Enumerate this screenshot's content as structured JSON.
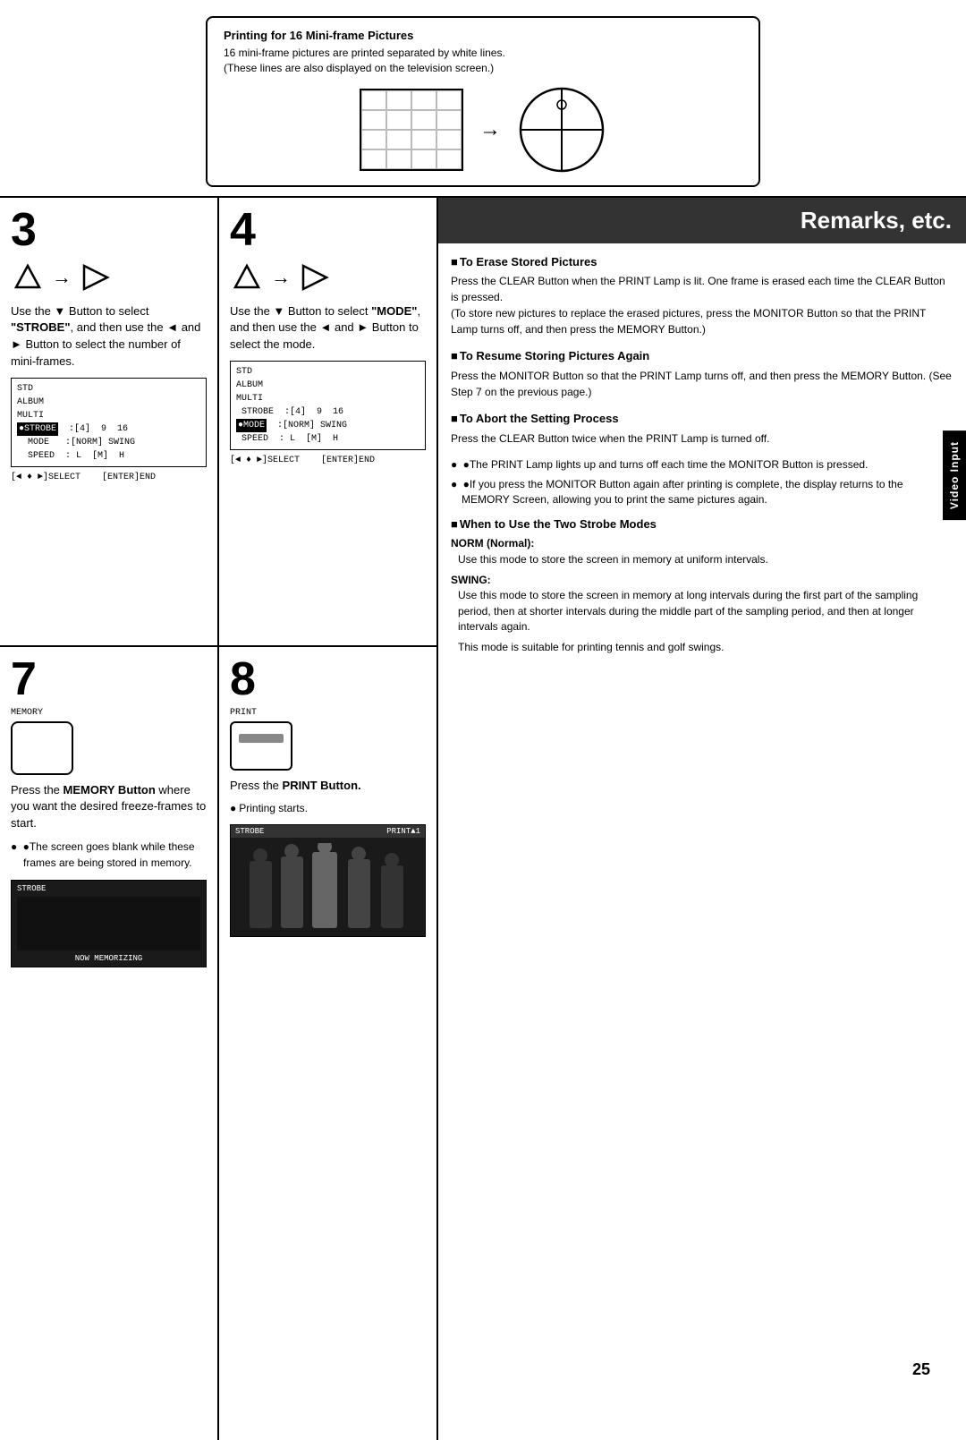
{
  "top": {
    "print_info_title": "Printing for 16 Mini-frame Pictures",
    "print_info_line1": "16 mini-frame pictures are printed separated by white lines.",
    "print_info_line2": "(These lines are also displayed on the television screen.)"
  },
  "steps": {
    "step3": {
      "number": "3",
      "description_html": "Use the ▼ Button to select \"STROBE\", and then use the ◄ and ► Button to select the number of mini-frames.",
      "menu": {
        "lines": [
          "STD",
          "ALBUM",
          "MULTI",
          "●STROBE  :[4]  9  16",
          "MODE  :[NORM]  SWING",
          "SPEED  : L  [M]  H"
        ],
        "footer": "[◄ ♦ ►]SELECT   [ENTER]END"
      }
    },
    "step4": {
      "number": "4",
      "description_html": "Use the ▼ Button to select \"MODE\", and then use the ◄ and ► Button to select the mode.",
      "menu": {
        "lines": [
          "STD",
          "ALBUM",
          "MULTI",
          "STROBE  :[4]  9  16",
          "●MODE  :[NORM]  SWING",
          "SPEED  : L  [M]  H"
        ],
        "footer": "[◄ ♦ ►]SELECT   [ENTER]END"
      }
    },
    "step7": {
      "number": "7",
      "memory_label": "MEMORY",
      "description": "Press the MEMORY Button where you want the desired freeze-frames to start.",
      "bullet1": "The screen goes blank while these frames are being stored in memory.",
      "strobe_label": "STROBE",
      "now_memorizing": "NOW MEMORIZING"
    },
    "step8": {
      "number": "8",
      "print_label": "PRINT",
      "description": "Press the PRINT Button.",
      "bullet1": "Printing starts.",
      "strobe_label": "STROBE",
      "print1_label": "PRINT▲1"
    }
  },
  "remarks": {
    "header": "Remarks, etc.",
    "erase_title": "To Erase Stored Pictures",
    "erase_text": "Press the CLEAR Button when the PRINT Lamp is lit. One frame is erased each time the CLEAR Button is pressed.\n(To store new pictures to replace the erased pictures, press the MONITOR Button so that the PRINT Lamp turns off, and then press the MEMORY Button.)",
    "resume_title": "To Resume Storing Pictures Again",
    "resume_text": "Press the MONITOR Button so that the PRINT Lamp turns off, and then press the MEMORY Button. (See Step 7 on the previous page.)",
    "abort_title": "To Abort the Setting Process",
    "abort_text": "Press the CLEAR Button twice when the PRINT Lamp is turned off.",
    "bullet1": "The PRINT Lamp lights up and turns off each time the MONITOR Button is pressed.",
    "bullet2": "If you press the MONITOR Button again after printing is complete, the display returns to the MEMORY Screen, allowing you to print the same pictures again.",
    "strobe_title": "When to Use the Two Strobe Modes",
    "norm_label": "NORM (Normal):",
    "norm_text": "Use this mode to store the screen in memory at uniform intervals.",
    "swing_label": "SWING:",
    "swing_text1": "Use this mode to store the screen in memory at long intervals during the first part of the sampling period, then at shorter intervals during the middle part of the sampling period, and then at longer intervals again.",
    "swing_text2": "This mode is suitable for printing tennis and golf swings.",
    "video_input_label": "Video Input"
  },
  "page_number": "25"
}
